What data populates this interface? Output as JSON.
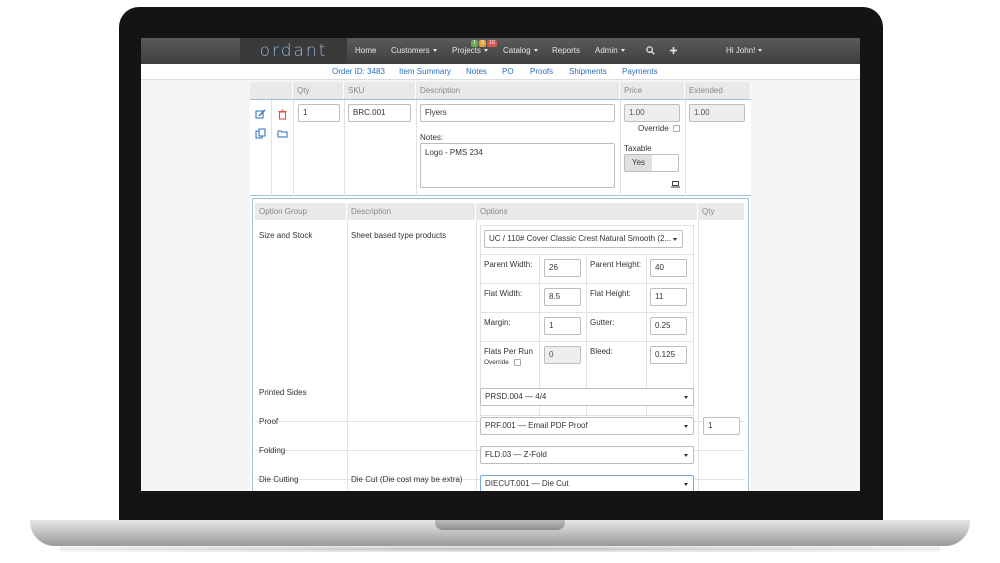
{
  "nav": {
    "brand": "ordant",
    "items": [
      {
        "label": "Home",
        "dropdown": false
      },
      {
        "label": "Customers",
        "dropdown": true
      },
      {
        "label": "Projects",
        "dropdown": true
      },
      {
        "label": "Catalog",
        "dropdown": true
      },
      {
        "label": "Reports",
        "dropdown": false
      },
      {
        "label": "Admin",
        "dropdown": true
      }
    ],
    "badges": [
      {
        "value": "1",
        "color": "#6aa84f"
      },
      {
        "value": "3",
        "color": "#e6a23c"
      },
      {
        "value": "10",
        "color": "#d9534f"
      }
    ],
    "search_icon": "search-icon",
    "add_icon": "plus-icon",
    "user_label": "Hi John!"
  },
  "subnav": {
    "links": [
      "Order ID: 3483",
      "Item Summary",
      "Notes",
      "PO",
      "Proofs",
      "Shipments",
      "Payments"
    ]
  },
  "item_table": {
    "headers": [
      "Qty",
      "SKU",
      "Description",
      "Price",
      "Extended"
    ],
    "qty": "1",
    "sku": "BRC.001",
    "description": "Flyers",
    "notes_label": "Notes:",
    "notes": "Logo - PMS 234",
    "price": "1.00",
    "override_label": "Override",
    "taxable_label": "Taxable",
    "taxable_value": "Yes",
    "extended": "1.00",
    "icons": [
      "edit-icon",
      "delete-icon",
      "copy-icon",
      "folder-icon",
      "laptop-icon"
    ]
  },
  "options_table": {
    "headers": [
      "Option Group",
      "Description",
      "Options",
      "Qty"
    ],
    "size_stock": {
      "group": "Size and Stock",
      "description": "Sheet based type products",
      "stock_select": "UC / 110# Cover Classic Crest Natural Smooth (2...",
      "fields": [
        {
          "label": "Parent Width:",
          "value": "26"
        },
        {
          "label": "Parent Height:",
          "value": "40"
        },
        {
          "label": "Flat Width:",
          "value": "8.5"
        },
        {
          "label": "Flat Height:",
          "value": "11"
        },
        {
          "label": "Margin:",
          "value": "1"
        },
        {
          "label": "Gutter:",
          "value": "0.25"
        },
        {
          "label": "Flats Per Run",
          "value": "0"
        },
        {
          "label": "Bleed:",
          "value": "0.125"
        }
      ],
      "override_label": "Override"
    },
    "rows": [
      {
        "group": "Printed Sides",
        "description": "",
        "option": "PRSD.004 — 4/4",
        "qty": ""
      },
      {
        "group": "Proof",
        "description": "",
        "option": "PRF.001 — Email PDF Proof",
        "qty": "1"
      },
      {
        "group": "Folding",
        "description": "",
        "option": "FLD.03 — Z-Fold",
        "qty": ""
      },
      {
        "group": "Die Cutting",
        "description": "Die Cut (Die cost may be extra)",
        "option": "DIECUT.001 — Die Cut",
        "qty": ""
      }
    ]
  }
}
